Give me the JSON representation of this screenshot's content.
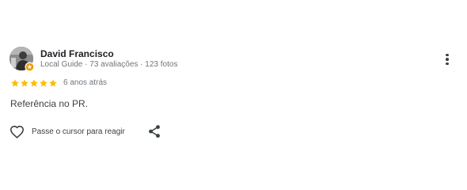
{
  "review": {
    "author": {
      "name": "David Francisco",
      "meta": "Local Guide · 73 avaliações · 123 fotos",
      "avatar_icon": "user-photo",
      "badge_icon": "local-guide-badge-icon"
    },
    "rating": {
      "stars": 5,
      "max": 5,
      "color": "#fbbc04"
    },
    "date": "6 anos atrás",
    "text": "Referência no PR.",
    "actions": {
      "like_label": "Passe o cursor para reagir",
      "like_icon": "heart-outline-icon",
      "share_icon": "share-icon",
      "more_icon": "more-vert-icon"
    }
  }
}
